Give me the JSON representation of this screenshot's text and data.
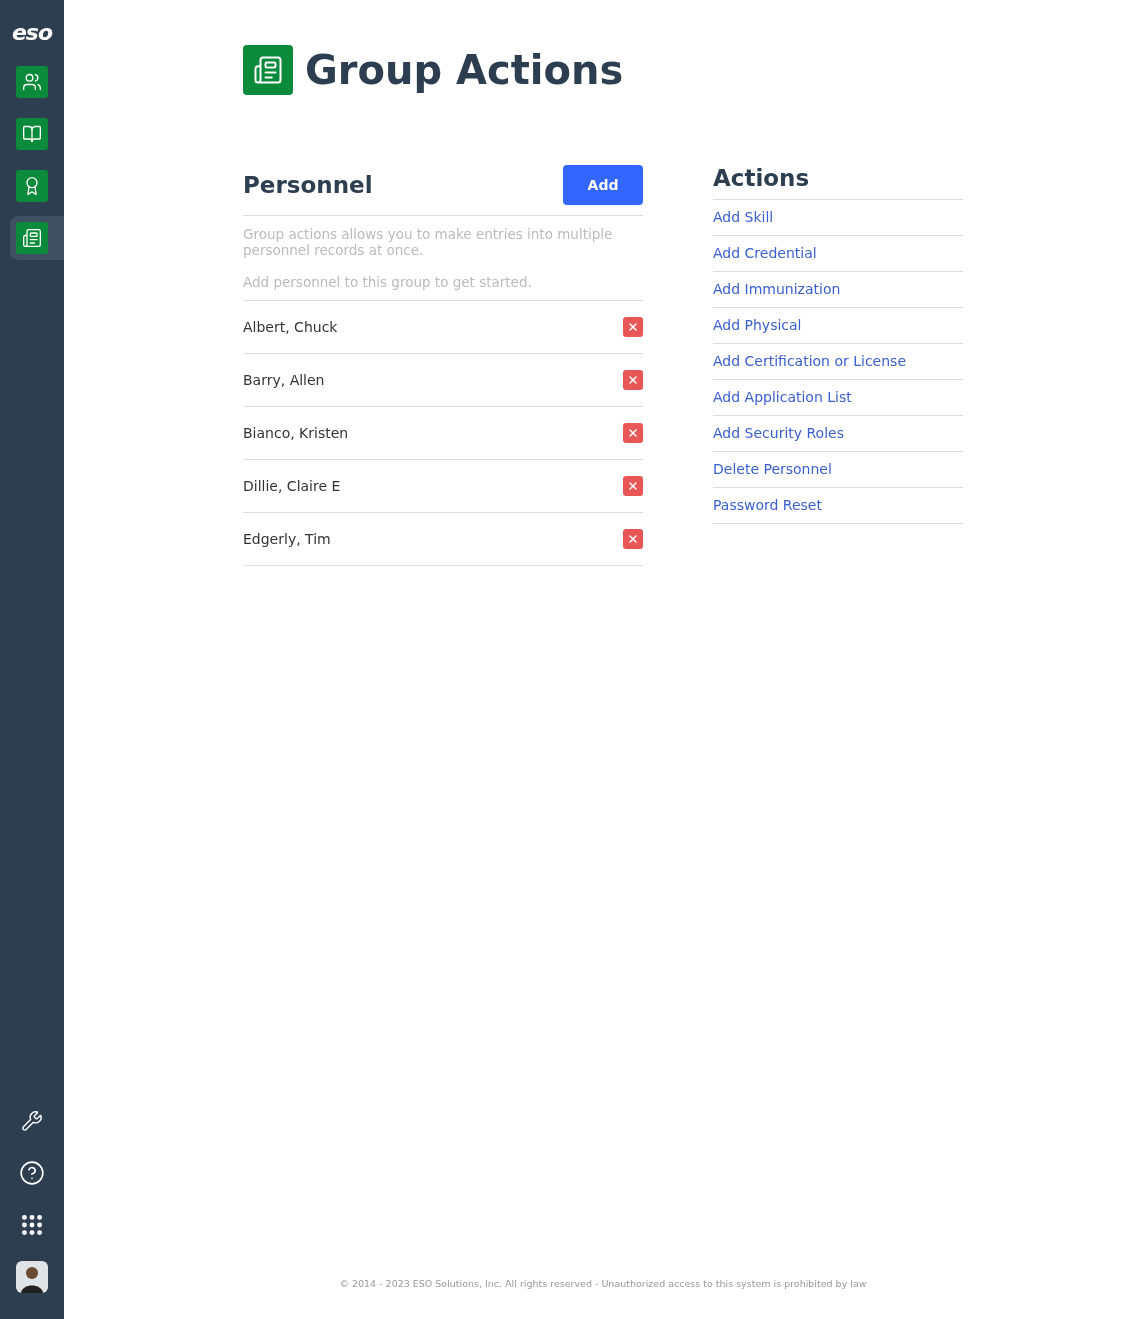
{
  "sidebar": {
    "logo": "eso",
    "nav": [
      {
        "selected": false
      },
      {
        "selected": false
      },
      {
        "selected": false
      },
      {
        "selected": true
      }
    ]
  },
  "header": {
    "title": "Group Actions"
  },
  "personnel": {
    "title": "Personnel",
    "add_button": "Add",
    "description": "Group actions allows you to make entries into multiple personnel records at once.",
    "hint": "Add personnel to this group to get started.",
    "members": [
      "Albert, Chuck",
      "Barry, Allen",
      "Bianco, Kristen",
      "Dillie, Claire E",
      "Edgerly, Tim"
    ]
  },
  "actions": {
    "title": "Actions",
    "links": [
      "Add Skill",
      "Add Credential",
      "Add Immunization",
      "Add Physical",
      "Add Certification or License",
      "Add Application List",
      "Add Security Roles",
      "Delete Personnel",
      "Password Reset"
    ]
  },
  "footer": "© 2014 - 2023 ESO Solutions, Inc. All rights reserved - Unauthorized access to this system is prohibited by law"
}
